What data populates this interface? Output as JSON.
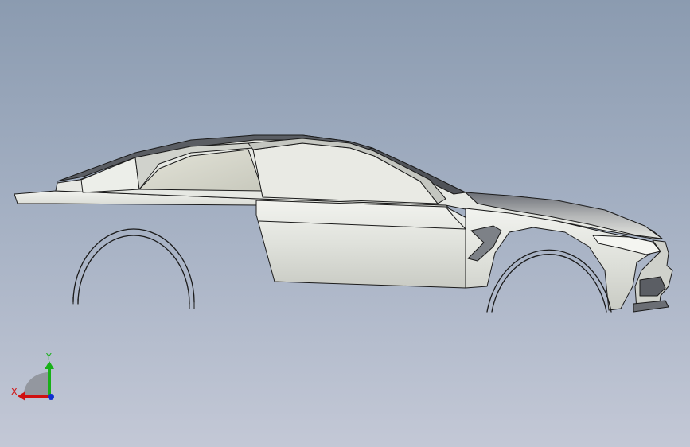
{
  "viewport": {
    "background_top": "#8b9bb0",
    "background_bottom": "#c3c8d6"
  },
  "model": {
    "edge_color": "#1a1a1a",
    "body_fill": "#e4e6e1",
    "glass_fill": "#d6d7cc",
    "roof_fill": "#5a5d63"
  },
  "triad": {
    "x_label": "X",
    "y_label": "Y",
    "x_color": "#d01010",
    "y_color": "#18b018",
    "z_color": "#1030d0"
  }
}
